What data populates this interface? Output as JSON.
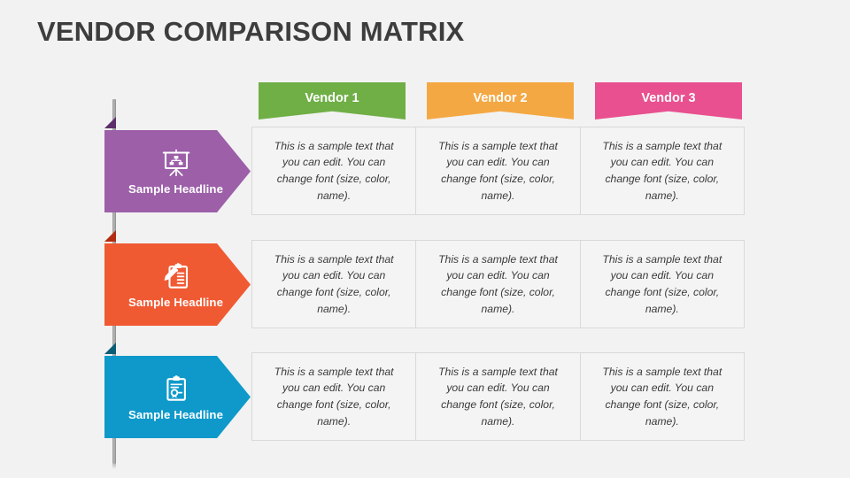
{
  "page": {
    "title": "VENDOR COMPARISON MATRIX",
    "background_color": "#f2f2f2",
    "title_color": "#3d3d3d"
  },
  "vendors": [
    {
      "label": "Vendor 1",
      "color": "#6FAF46"
    },
    {
      "label": "Vendor 2",
      "color": "#F4A843"
    },
    {
      "label": "Vendor 3",
      "color": "#E9508F"
    }
  ],
  "rows": [
    {
      "headline": "Sample Headline",
      "color": "#9C5FA8",
      "fold_color": "#5E2E6B",
      "icon": "presentation-chart-icon",
      "cells": [
        "This is a sample text that you can edit. You can change font (size, color, name).",
        "This is a sample text that you can edit. You can change font (size, color, name).",
        "This is a sample text that you can edit. You can change font (size, color, name)."
      ]
    },
    {
      "headline": "Sample Headline",
      "color": "#F05A33",
      "fold_color": "#B32B11",
      "icon": "clipboard-pencil-icon",
      "cells": [
        "This is a sample text that you can edit. You can change font (size, color, name).",
        "This is a sample text that you can edit. You can change font (size, color, name).",
        "This is a sample text that you can edit. You can change font (size, color, name)."
      ]
    },
    {
      "headline": "Sample Headline",
      "color": "#0E99CA",
      "fold_color": "#0B5E77",
      "icon": "clipboard-award-icon",
      "cells": [
        "This is a sample text that you can edit. You can change font (size, color, name).",
        "This is a sample text that you can edit. You can change font (size, color, name).",
        "This is a sample text that you can edit. You can change font (size, color, name)."
      ]
    }
  ]
}
